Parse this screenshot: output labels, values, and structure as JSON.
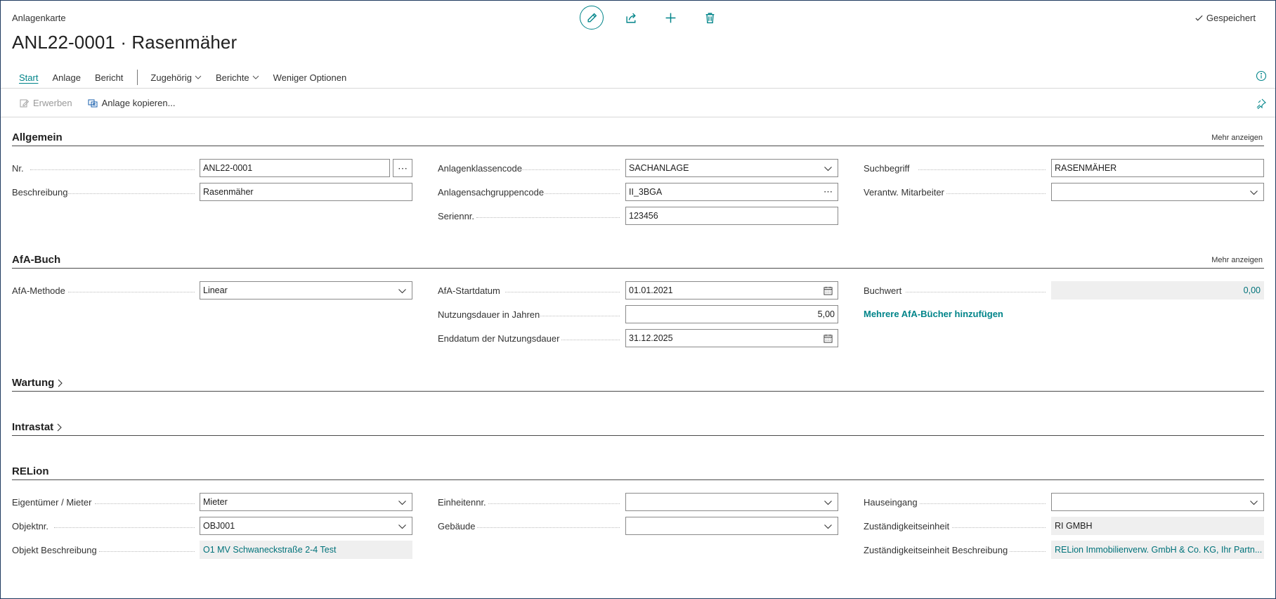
{
  "header": {
    "caption": "Anlagenkarte",
    "title": "ANL22-0001 · Rasenmäher",
    "saved_label": "Gespeichert"
  },
  "top_actions": [
    "edit-icon",
    "share-icon",
    "plus-icon",
    "trash-icon"
  ],
  "actionbar": {
    "items": [
      "Start",
      "Anlage",
      "Bericht",
      "Zugehörig",
      "Berichte",
      "Weniger Optionen"
    ]
  },
  "subbar": {
    "erwerben": "Erwerben",
    "kopieren": "Anlage kopieren..."
  },
  "sections": {
    "allgemein": {
      "title": "Allgemein",
      "more": "Mehr anzeigen",
      "nr_label": "Nr.",
      "nr_value": "ANL22-0001",
      "beschreibung_label": "Beschreibung",
      "beschreibung_value": "Rasenmäher",
      "klassencode_label": "Anlagenklassencode",
      "klassencode_value": "SACHANLAGE",
      "sachgruppencode_label": "Anlagensachgruppencode",
      "sachgruppencode_value": "II_3BGA",
      "seriennr_label": "Seriennr.",
      "seriennr_value": "123456",
      "suchbegriff_label": "Suchbegriff",
      "suchbegriff_value": "RASENMÄHER",
      "mitarbeiter_label": "Verantw. Mitarbeiter",
      "mitarbeiter_value": ""
    },
    "afa": {
      "title": "AfA-Buch",
      "more": "Mehr anzeigen",
      "methode_label": "AfA-Methode",
      "methode_value": "Linear",
      "startdatum_label": "AfA-Startdatum",
      "startdatum_value": "01.01.2021",
      "dauer_label": "Nutzungsdauer in Jahren",
      "dauer_value": "5,00",
      "enddatum_label": "Enddatum der Nutzungsdauer",
      "enddatum_value": "31.12.2025",
      "buchwert_label": "Buchwert",
      "buchwert_value": "0,00",
      "add_books_link": "Mehrere AfA-Bücher hinzufügen"
    },
    "wartung": {
      "title": "Wartung"
    },
    "intrastat": {
      "title": "Intrastat"
    },
    "relion": {
      "title": "RELion",
      "eigentuemer_label": "Eigentümer / Mieter",
      "eigentuemer_value": "Mieter",
      "objektnr_label": "Objektnr.",
      "objektnr_value": "OBJ001",
      "objekt_beschr_label": "Objekt Beschreibung",
      "objekt_beschr_value": "O1 MV Schwaneckstraße 2-4 Test",
      "einheitennr_label": "Einheitennr.",
      "einheitennr_value": "",
      "gebaeude_label": "Gebäude",
      "gebaeude_value": "",
      "hauseingang_label": "Hauseingang",
      "hauseingang_value": "",
      "zust_label": "Zuständigkeitseinheit",
      "zust_value": "RI GMBH",
      "zust_beschr_label": "Zuständigkeitseinheit Beschreibung",
      "zust_beschr_value": "RELion Immobilienverw. GmbH & Co. KG, Ihr Partn..."
    }
  },
  "colors": {
    "accent": "#008489",
    "link": "#00727a",
    "border": "#8a8a8a",
    "readonly_bg": "#efefef"
  }
}
